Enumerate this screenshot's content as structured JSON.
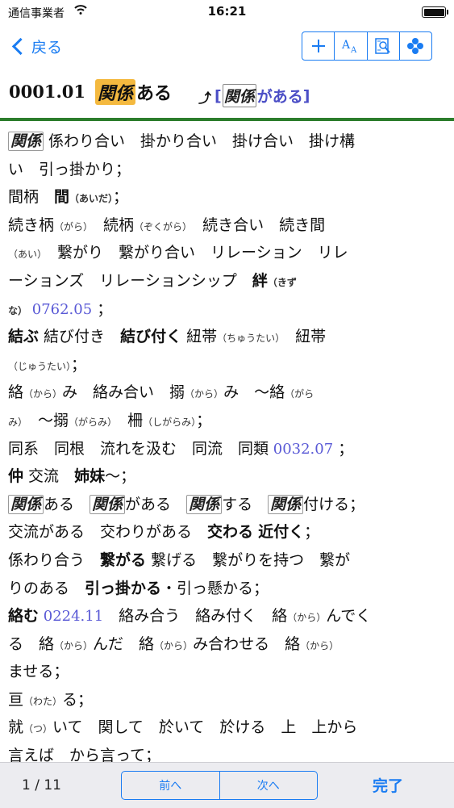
{
  "status_bar": {
    "carrier": "通信事業者",
    "time": "16:21"
  },
  "nav": {
    "back_label": "戻る",
    "tools": [
      {
        "name": "add",
        "icon": "plus-icon"
      },
      {
        "name": "font-size",
        "icon": "font-size-icon"
      },
      {
        "name": "search",
        "icon": "search-doc-icon"
      },
      {
        "name": "menu",
        "icon": "diamond-dots-icon"
      }
    ]
  },
  "heading": {
    "number": "0001.01",
    "term_highlight": "関係",
    "term_rest": "ある",
    "arrow_icon": "up-arrow-icon",
    "link_open": "[",
    "link_box": "関係",
    "link_rest": "がある",
    "link_close": "]"
  },
  "colors": {
    "accent": "#1a7cf2",
    "highlight": "#f4b93f",
    "divider": "#2c7d2c",
    "reference": "#5a5ad6"
  },
  "entry": {
    "l1": {
      "box": "関係",
      "text": " 係わり合い　掛かり合い　掛け合い　掛け構"
    },
    "l2": {
      "text": "い　引っ掛かり；"
    },
    "l3": {
      "a": "間柄　",
      "b": "間",
      "r": "（あいだ）",
      "c": "；"
    },
    "l4": {
      "a": "続き柄",
      "r1": "（がら）",
      "b": "　続柄",
      "r2": "（ぞくがら）",
      "c": "　続き合い　続き間"
    },
    "l5": {
      "r": "（あい）",
      "a": "　繋がり　繋がり合い　リレーション　リレ"
    },
    "l6": {
      "a": "ーションズ　リレーションシップ　",
      "b": "絆",
      "r": "（きず"
    },
    "l7": {
      "r": "な）",
      "ref": " 0762.05",
      "c": " ；"
    },
    "l8": {
      "b1": "結ぶ",
      "a": " 結び付き　",
      "b2": "結び付く",
      "c": " 紐帯",
      "r": "（ちゅうたい）",
      "d": "　紐帯"
    },
    "l9": {
      "r": "（じゅうたい）",
      "a": "；"
    },
    "l10": {
      "a": "絡",
      "r1": "（から）",
      "b": "み　絡み合い　搦",
      "r2": "（から）",
      "c": "み　～絡",
      "r3": "（がら"
    },
    "l11": {
      "r1": "み）",
      "a": "　～搦",
      "r2": "（がらみ）",
      "b": "　柵",
      "r3": "（しがらみ）",
      "c": "；"
    },
    "l12": {
      "a": "同系　同根　流れを汲む　同流　同類",
      "ref": " 0032.07",
      "c": " ；"
    },
    "l13": {
      "b1": "仲",
      "a": " 交流　",
      "b2": "姉妹",
      "c": "～；"
    },
    "l14": {
      "box1": "関係",
      "a": "ある　",
      "box2": "関係",
      "b": "がある　",
      "box3": "関係",
      "c": "する　",
      "box4": "関係",
      "d": "付ける；"
    },
    "l15": {
      "a": "交流がある　交わりがある　",
      "b1": "交わる",
      "c": " ",
      "b2": "近付く",
      "d": "；"
    },
    "l16": {
      "a": "係わり合う　",
      "b": "繋がる",
      "c": " 繋げる　繋がりを持つ　繋が"
    },
    "l17": {
      "a": "りのある　",
      "b": "引っ掛かる",
      "c": "・引っ懸かる；"
    },
    "l18": {
      "b": "絡む",
      "ref": " 0224.11",
      "a": "　絡み合う　絡み付く　絡",
      "r": "（から）",
      "c": "んでく"
    },
    "l19": {
      "a": "る　絡",
      "r1": "（から）",
      "b": "んだ　絡",
      "r2": "（から）",
      "c": "み合わせる　絡",
      "r3": "（から）"
    },
    "l20": {
      "a": "ませる；"
    },
    "l21": {
      "a": "亘",
      "r": "（わた）",
      "b": "る；"
    },
    "l22": {
      "a": "就",
      "r": "（つ）",
      "b": "いて　関して　於いて　於ける　上　上から"
    },
    "l23": {
      "a": "言えば　から言って；"
    }
  },
  "bottom": {
    "pager": "1 / 11",
    "prev_label": "前へ",
    "next_label": "次へ",
    "done_label": "完了"
  }
}
